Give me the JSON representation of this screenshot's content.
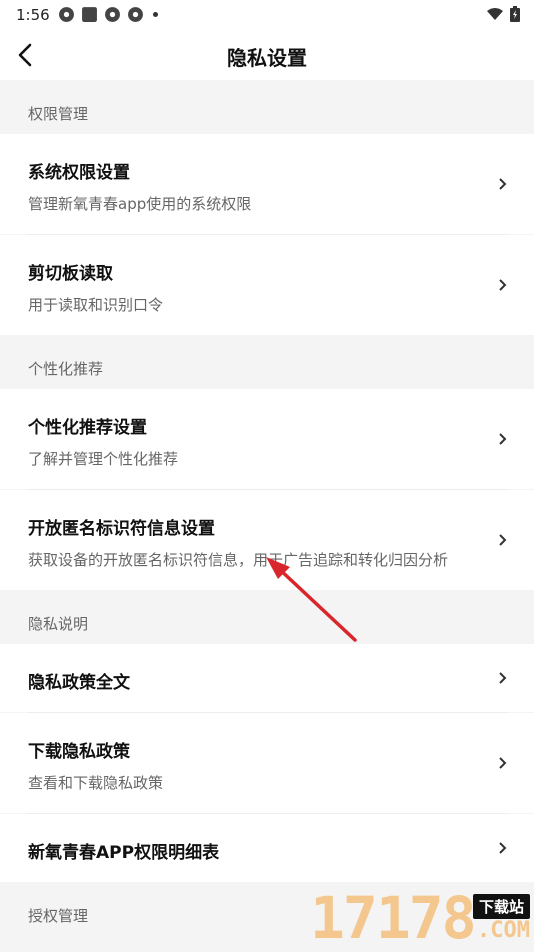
{
  "status": {
    "time": "1:56"
  },
  "header": {
    "title": "隐私设置"
  },
  "sections": {
    "perm": {
      "label": "权限管理"
    },
    "personal": {
      "label": "个性化推荐"
    },
    "privacy": {
      "label": "隐私说明"
    },
    "auth": {
      "label": "授权管理"
    }
  },
  "items": {
    "system_perm": {
      "title": "系统权限设置",
      "subtitle": "管理新氧青春app使用的系统权限"
    },
    "clipboard": {
      "title": "剪切板读取",
      "subtitle": "用于读取和识别口令"
    },
    "rec_settings": {
      "title": "个性化推荐设置",
      "subtitle": "了解并管理个性化推荐"
    },
    "oaid": {
      "title": "开放匿名标识符信息设置",
      "subtitle": "获取设备的开放匿名标识符信息，用于广告追踪和转化归因分析"
    },
    "policy_full": {
      "title": "隐私政策全文"
    },
    "policy_download": {
      "title": "下载隐私政策",
      "subtitle": "查看和下载隐私政策"
    },
    "perm_list": {
      "title": "新氧青春APP权限明细表"
    }
  },
  "watermark": {
    "number": "17178",
    "tag": "下载站",
    "domain": ".COM"
  },
  "colors": {
    "annotation_arrow": "#d9262c",
    "watermark": "#f3c78d"
  }
}
